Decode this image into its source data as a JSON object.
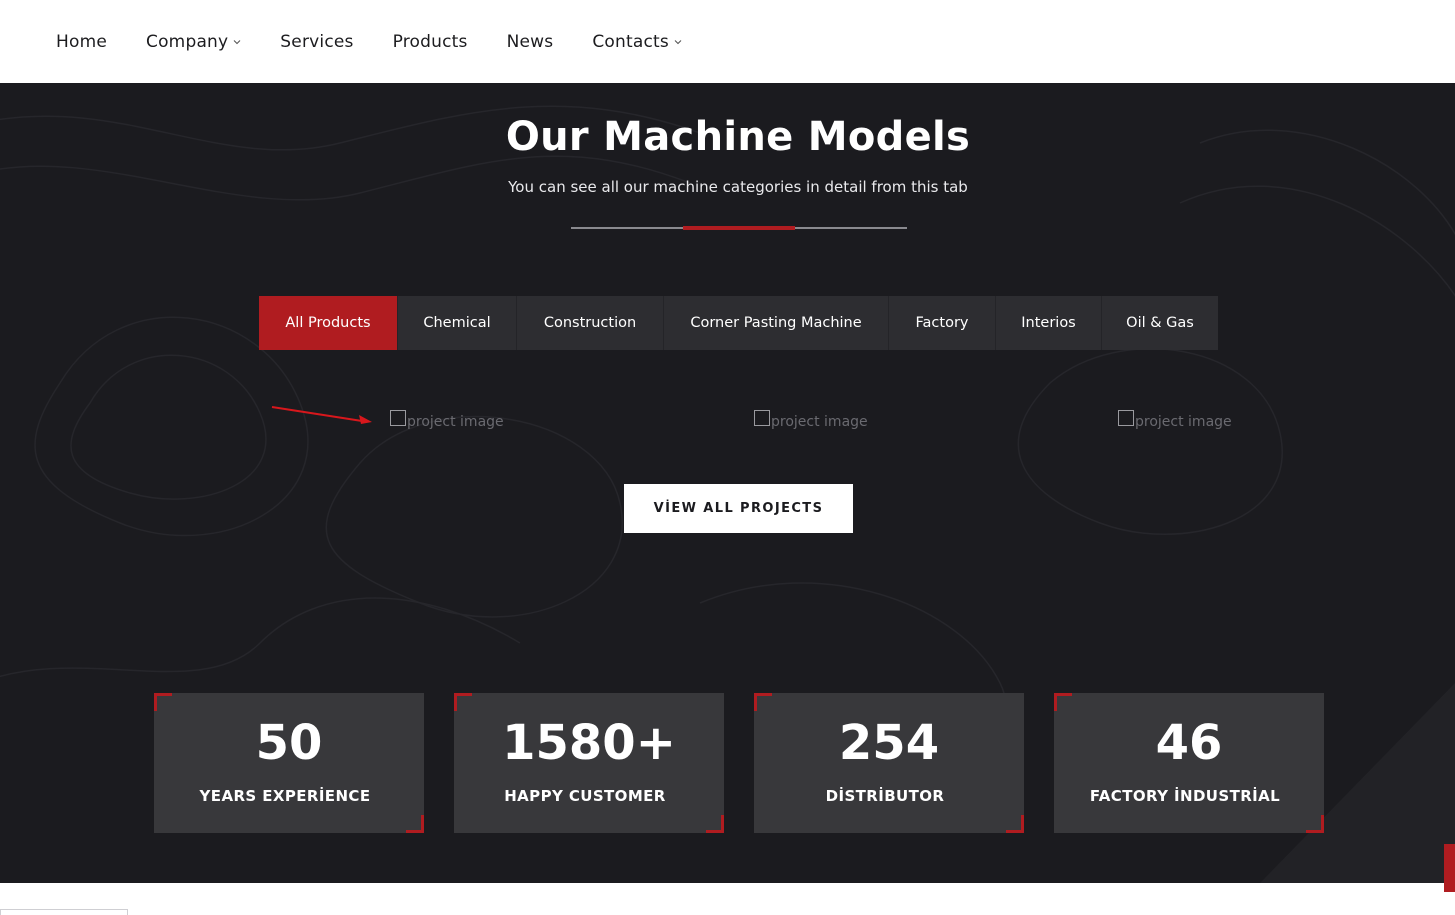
{
  "nav": {
    "items": [
      {
        "label": "Home",
        "dropdown": false
      },
      {
        "label": "Company",
        "dropdown": true
      },
      {
        "label": "Services",
        "dropdown": false
      },
      {
        "label": "Products",
        "dropdown": false
      },
      {
        "label": "News",
        "dropdown": false
      },
      {
        "label": "Contacts",
        "dropdown": true
      }
    ]
  },
  "section": {
    "title": "Our Machine Models",
    "subtitle": "You can see all our machine categories in detail from this tab"
  },
  "tabs": [
    {
      "label": "All Products",
      "active": true
    },
    {
      "label": "Chemical",
      "active": false
    },
    {
      "label": "Construction",
      "active": false
    },
    {
      "label": "Corner Pasting Machine",
      "active": false
    },
    {
      "label": "Factory",
      "active": false
    },
    {
      "label": "Interios",
      "active": false
    },
    {
      "label": "Oil & Gas",
      "active": false
    }
  ],
  "projects": [
    {
      "alt": "project image"
    },
    {
      "alt": "project image"
    },
    {
      "alt": "project image"
    }
  ],
  "view_all": {
    "label": "VİEW ALL PROJECTS"
  },
  "stats": [
    {
      "value": "50",
      "label": "YEARS EXPERİENCE"
    },
    {
      "value": "1580+",
      "label": "HAPPY CUSTOMER"
    },
    {
      "value": "254",
      "label": "DİSTRİBUTOR"
    },
    {
      "value": "46",
      "label": "FACTORY İNDUSTRİAL"
    }
  ],
  "colors": {
    "accent": "#b01c20",
    "dark_bg": "#1b1b1f",
    "tab_bg": "#2d2d31",
    "stat_bg": "#38383b"
  },
  "icons": {
    "dropdown": "chevron-down-icon",
    "annotation": "red-arrow-icon",
    "broken_image": "broken-image-icon"
  }
}
